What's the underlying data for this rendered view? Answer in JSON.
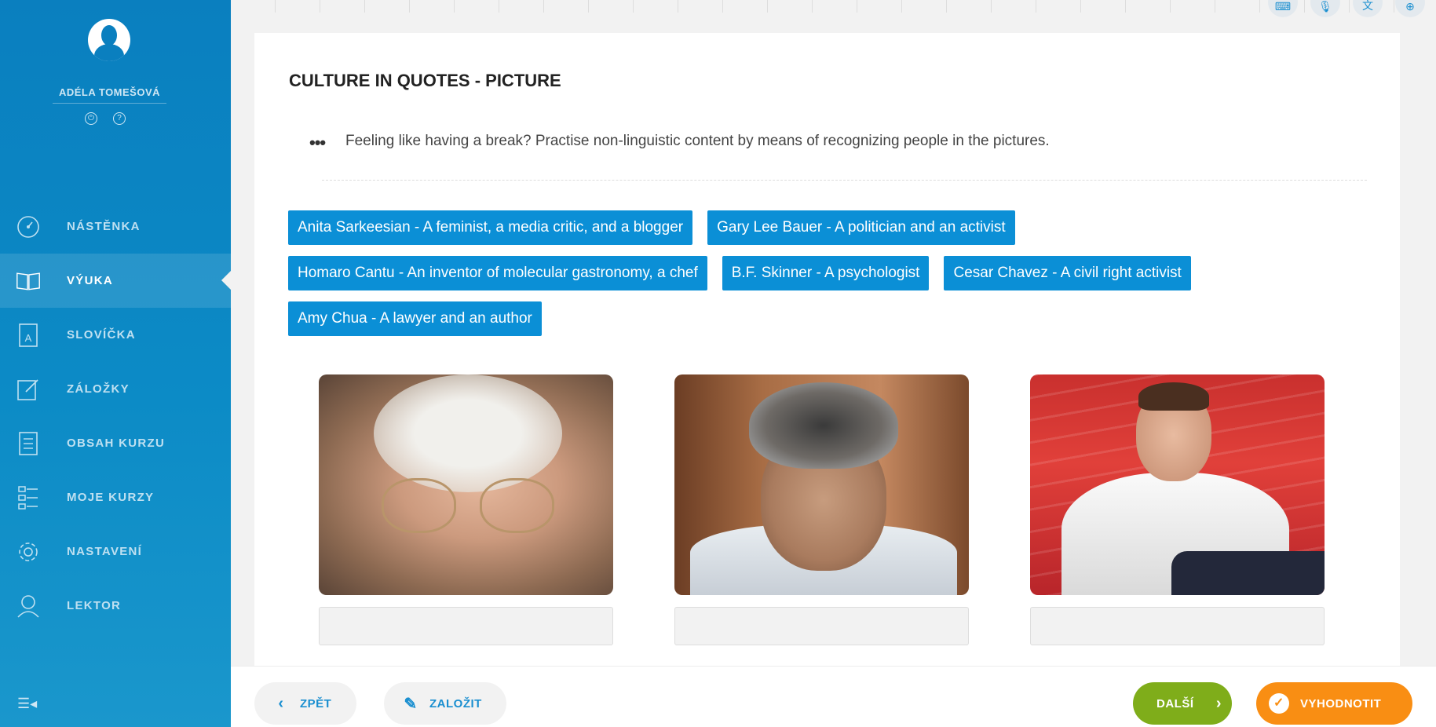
{
  "user": {
    "name": "ADÉLA TOMEŠOVÁ"
  },
  "nav": {
    "items": [
      {
        "label": "NÁSTĚNKA",
        "icon": "dashboard-icon"
      },
      {
        "label": "VÝUKA",
        "icon": "book-icon",
        "active": true
      },
      {
        "label": "SLOVÍČKA",
        "icon": "vocabulary-icon"
      },
      {
        "label": "ZÁLOŽKY",
        "icon": "bookmark-edit-icon"
      },
      {
        "label": "OBSAH KURZU",
        "icon": "course-content-icon"
      },
      {
        "label": "MOJE KURZY",
        "icon": "my-courses-icon"
      },
      {
        "label": "NASTAVENÍ",
        "icon": "gear-icon"
      },
      {
        "label": "LEKTOR",
        "icon": "tutor-icon"
      }
    ]
  },
  "exercise": {
    "title": "CULTURE IN QUOTES - PICTURE",
    "instructions": "Feeling like having a break? Practise non-linguistic content by means of recognizing people in the pictures.",
    "options": [
      "Anita Sarkeesian - A feminist, a media critic, and a blogger",
      "Gary Lee Bauer - A politician and an activist",
      "Homaro Cantu - An inventor of molecular gastronomy, a chef",
      "B.F. Skinner - A psychologist",
      "Cesar Chavez - A civil right activist",
      "Amy Chua - A lawyer and an author"
    ]
  },
  "footer": {
    "back_label": "ZPĚT",
    "bookmark_label": "ZALOŽIT",
    "next_label": "DALŠÍ",
    "evaluate_label": "VYHODNOTIT"
  },
  "colors": {
    "sidebar": "#0a7fbf",
    "chip": "#0b8fd6",
    "next": "#7fad1a",
    "evaluate": "#f98e13"
  }
}
